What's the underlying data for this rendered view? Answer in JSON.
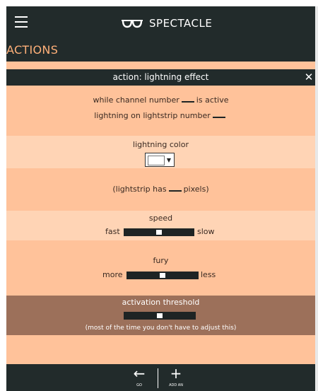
{
  "app": {
    "name": "SPECTACLE"
  },
  "section": {
    "title": "ACTIONS"
  },
  "action": {
    "title": "action: lightning effect",
    "close": "✕",
    "line1_pre": "while channel number",
    "line1_post": "is active",
    "line2_pre": "lightning on lightstrip number",
    "color_label": "lightning color",
    "color_value": "#ffffff",
    "pixels_pre": "(lightstrip has",
    "pixels_post": "pixels)",
    "speed": {
      "title": "speed",
      "left": "fast",
      "right": "slow",
      "value": 0.5
    },
    "fury": {
      "title": "fury",
      "left": "more",
      "right": "less",
      "value": 0.5
    },
    "threshold": {
      "title": "activation threshold",
      "value": 0.5,
      "note": "(most of the time you don't have to adjust this)"
    }
  },
  "bottom_nav": {
    "go": {
      "icon": "arrow-left-icon",
      "glyph": "←",
      "label": "GO"
    },
    "add": {
      "icon": "plus-icon",
      "glyph": "+",
      "label": "ADD AN"
    }
  },
  "colors": {
    "bar": "#222b2b",
    "accent": "#ffb079",
    "panel": "#ffc29a",
    "panel_light": "#ffd4b5",
    "panel_dark": "#9c705a"
  }
}
